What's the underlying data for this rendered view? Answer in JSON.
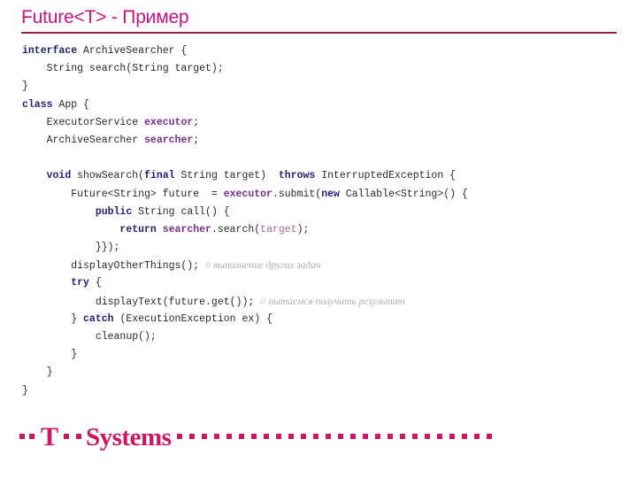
{
  "slide": {
    "title": "Future<T> - Пример",
    "accent_color": "#C8127D",
    "rule_color": "#9E2050",
    "background": "#ffffff"
  },
  "code": {
    "language": "java",
    "lines": [
      [
        {
          "t": "interface ",
          "c": "kw"
        },
        {
          "t": "ArchiveSearcher {",
          "c": "pln"
        }
      ],
      [
        {
          "t": "    String search(String target);",
          "c": "pln"
        }
      ],
      [
        {
          "t": "}",
          "c": "pln"
        }
      ],
      [
        {
          "t": "class ",
          "c": "kw"
        },
        {
          "t": "App {",
          "c": "pln"
        }
      ],
      [
        {
          "t": "    ExecutorService ",
          "c": "pln"
        },
        {
          "t": "executor",
          "c": "fld"
        },
        {
          "t": ";",
          "c": "pln"
        }
      ],
      [
        {
          "t": "    ArchiveSearcher ",
          "c": "pln"
        },
        {
          "t": "searcher",
          "c": "fld"
        },
        {
          "t": ";",
          "c": "pln"
        }
      ],
      [
        {
          "t": "",
          "c": "pln"
        }
      ],
      [
        {
          "t": "    ",
          "c": "pln"
        },
        {
          "t": "void ",
          "c": "kw"
        },
        {
          "t": "showSearch(",
          "c": "pln"
        },
        {
          "t": "final ",
          "c": "kw"
        },
        {
          "t": "String target)  ",
          "c": "pln"
        },
        {
          "t": "throws ",
          "c": "kw"
        },
        {
          "t": "InterruptedException {",
          "c": "pln"
        }
      ],
      [
        {
          "t": "        Future<String> future  = ",
          "c": "pln"
        },
        {
          "t": "executor",
          "c": "fld"
        },
        {
          "t": ".submit(",
          "c": "pln"
        },
        {
          "t": "new ",
          "c": "kw"
        },
        {
          "t": "Callable<String>() {",
          "c": "pln"
        }
      ],
      [
        {
          "t": "            ",
          "c": "pln"
        },
        {
          "t": "public ",
          "c": "kw"
        },
        {
          "t": "String call() {",
          "c": "pln"
        }
      ],
      [
        {
          "t": "                ",
          "c": "pln"
        },
        {
          "t": "return ",
          "c": "kw"
        },
        {
          "t": "searcher",
          "c": "fld"
        },
        {
          "t": ".search(",
          "c": "pln"
        },
        {
          "t": "target",
          "c": "var"
        },
        {
          "t": ");",
          "c": "pln"
        }
      ],
      [
        {
          "t": "            }});",
          "c": "pln"
        }
      ],
      [
        {
          "t": "        displayOtherThings(); ",
          "c": "pln"
        },
        {
          "t": "// выполнение других задач",
          "c": "cmt"
        }
      ],
      [
        {
          "t": "        ",
          "c": "pln"
        },
        {
          "t": "try ",
          "c": "kw"
        },
        {
          "t": "{",
          "c": "pln"
        }
      ],
      [
        {
          "t": "            displayText(future.get()); ",
          "c": "pln"
        },
        {
          "t": "// пытаемся получить результат",
          "c": "cmt"
        }
      ],
      [
        {
          "t": "        } ",
          "c": "pln"
        },
        {
          "t": "catch ",
          "c": "kw"
        },
        {
          "t": "(ExecutionException ex) {",
          "c": "pln"
        }
      ],
      [
        {
          "t": "            cleanup();",
          "c": "pln"
        }
      ],
      [
        {
          "t": "        }",
          "c": "pln"
        }
      ],
      [
        {
          "t": "    }",
          "c": "pln"
        }
      ],
      [
        {
          "t": "}",
          "c": "pln"
        }
      ]
    ],
    "syntax_colors": {
      "keyword": "#1F1F7A",
      "field": "#7B2D8E",
      "variable": "#9B6F9B",
      "comment": "#AFAFAF",
      "plain": "#2A2A2A"
    }
  },
  "footer": {
    "logo_t": "T",
    "logo_word": "Systems",
    "logo_color": "#CE1762",
    "lead_dots": 2,
    "mid_dots": 2,
    "trail_dots": 26
  }
}
